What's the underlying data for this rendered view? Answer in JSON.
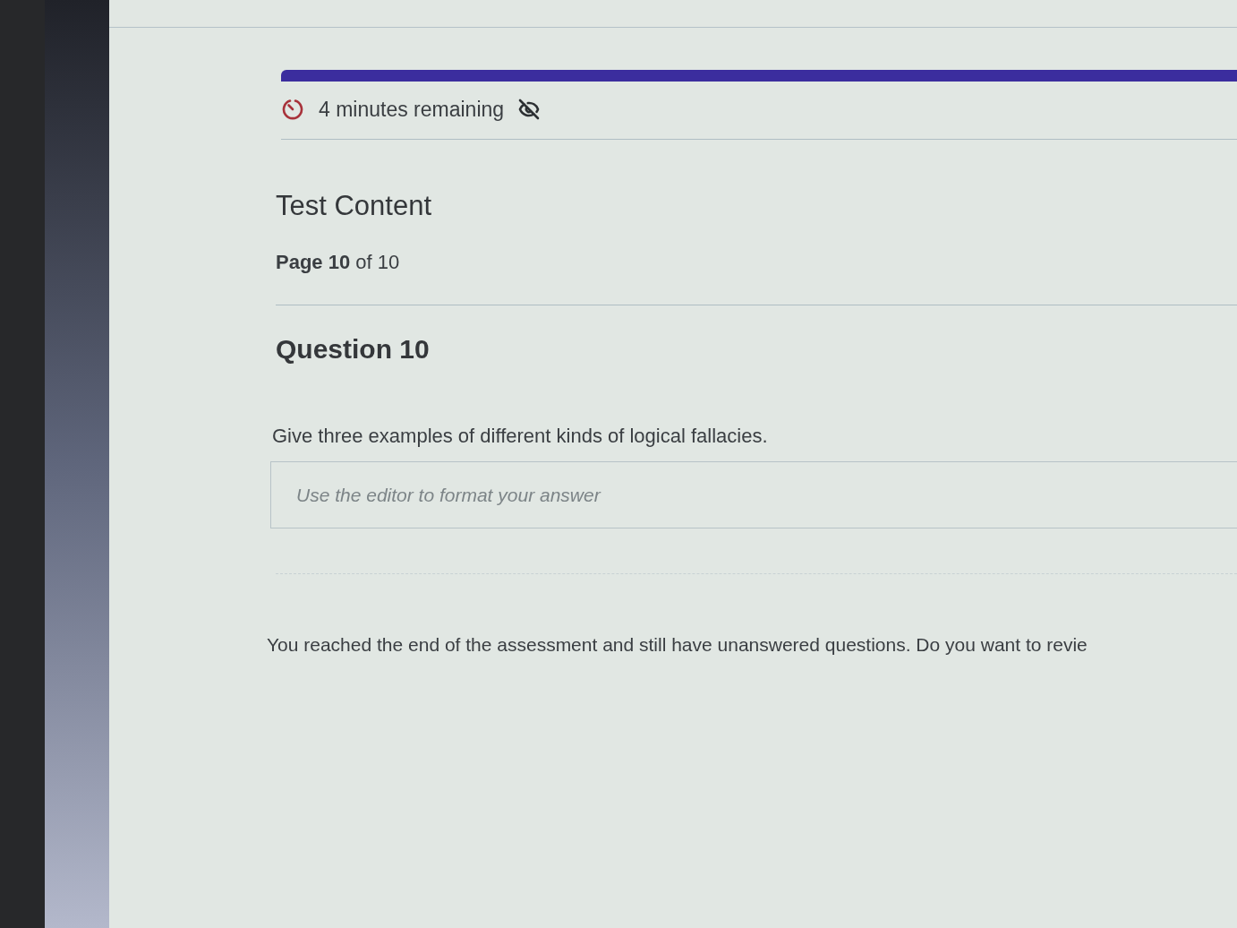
{
  "timer": {
    "remaining": "4 minutes remaining"
  },
  "section": {
    "title": "Test Content",
    "page": "**Page 10** of 10"
  },
  "question": {
    "title": "Question 10",
    "prompt": "Give three examples of different kinds of logical fallacies.",
    "answer": {
      "placeholder": "Use the editor to format your answer"
    }
  },
  "end_message": "You reached the end of the assessment and still have unanswered questions. Do you want to revie"
}
